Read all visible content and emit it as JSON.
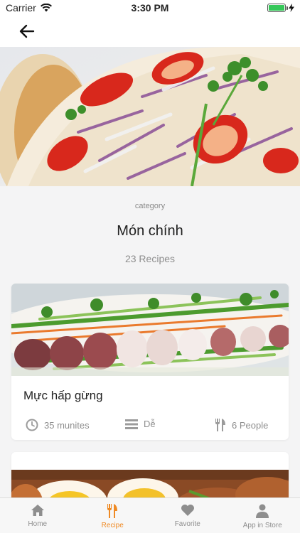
{
  "status_bar": {
    "carrier": "Carrier",
    "time": "3:30 PM",
    "battery_percent": 100
  },
  "header": {
    "back_icon": "arrow-left-icon"
  },
  "category": {
    "label": "category",
    "title": "Món chính",
    "count": "23 Recipes"
  },
  "recipes": [
    {
      "title": "Mực hấp gừng",
      "time": "35 munites",
      "level": "Dễ",
      "people": "6 People",
      "icons": {
        "time": "clock-icon",
        "level": "bars-icon",
        "people": "fork-knife-icon"
      }
    },
    {
      "title": ""
    }
  ],
  "tabs": [
    {
      "label": "Home",
      "icon": "home-icon",
      "active": false
    },
    {
      "label": "Recipe",
      "icon": "utensils-icon",
      "active": true
    },
    {
      "label": "Favorite",
      "icon": "heart-icon",
      "active": false
    },
    {
      "label": "App in Store",
      "icon": "user-icon",
      "active": false
    }
  ],
  "colors": {
    "accent": "#ef8a24",
    "muted": "#8e8e8e",
    "background": "#f4f4f5"
  }
}
